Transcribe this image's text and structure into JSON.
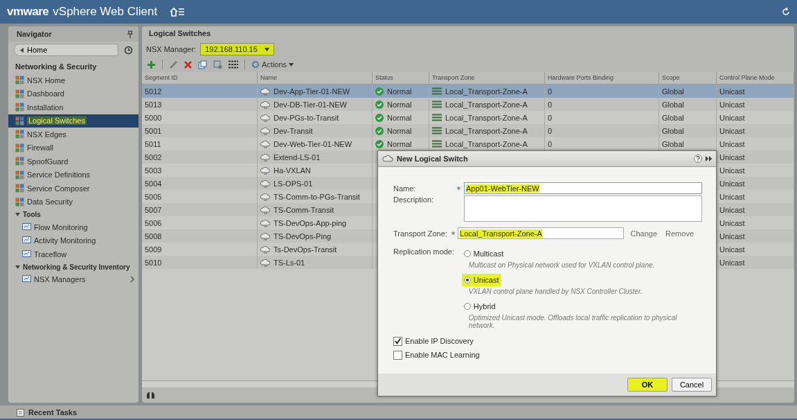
{
  "app_title": {
    "brand": "vmware",
    "product": "vSphere Web Client"
  },
  "navigator": {
    "title": "Navigator",
    "back_label": "Home",
    "items": [
      {
        "kind": "section",
        "label": "Networking & Security"
      },
      {
        "kind": "item",
        "label": "NSX Home",
        "selected": false,
        "highlighted": false
      },
      {
        "kind": "item",
        "label": "Dashboard",
        "selected": false,
        "highlighted": false
      },
      {
        "kind": "item",
        "label": "Installation",
        "selected": false,
        "highlighted": false
      },
      {
        "kind": "item",
        "label": "Logical Switches",
        "selected": true,
        "highlighted": true
      },
      {
        "kind": "item",
        "label": "NSX Edges",
        "selected": false,
        "highlighted": false
      },
      {
        "kind": "item",
        "label": "Firewall",
        "selected": false,
        "highlighted": false
      },
      {
        "kind": "item",
        "label": "SpoofGuard",
        "selected": false,
        "highlighted": false
      },
      {
        "kind": "item",
        "label": "Service Definitions",
        "selected": false,
        "highlighted": false
      },
      {
        "kind": "item",
        "label": "Service Composer",
        "selected": false,
        "highlighted": false
      },
      {
        "kind": "item",
        "label": "Data Security",
        "selected": false,
        "highlighted": false
      },
      {
        "kind": "group",
        "label": "Tools",
        "expanded": true,
        "children": [
          {
            "label": "Flow Monitoring",
            "selected": false,
            "submenu": false
          },
          {
            "label": "Activity Monitoring",
            "selected": false,
            "submenu": false
          },
          {
            "label": "Traceflow",
            "selected": false,
            "submenu": false
          }
        ]
      },
      {
        "kind": "group",
        "label": "Networking & Security Inventory",
        "expanded": true,
        "children": [
          {
            "label": "NSX Managers",
            "selected": false,
            "submenu": true
          }
        ]
      }
    ]
  },
  "main": {
    "title": "Logical Switches",
    "manager_label": "NSX Manager:",
    "manager_value": "192.168.110.15",
    "manager_highlighted": true,
    "actions_label": "Actions",
    "table": {
      "columns": [
        "Segment ID",
        "Name",
        "Status",
        "Transport Zone",
        "Hardware Ports Binding",
        "Scope",
        "Control Plane Mode"
      ],
      "rows": [
        {
          "segment_id": "5012",
          "name": "Dev-App-Tier-01-NEW",
          "status": "Normal",
          "transport_zone": "Local_Transport-Zone-A",
          "hardware_ports_binding": "0",
          "scope": "Global",
          "control_plane_mode": "Unicast",
          "selected": true
        },
        {
          "segment_id": "5013",
          "name": "Dev-DB-Tier-01-NEW",
          "status": "Normal",
          "transport_zone": "Local_Transport-Zone-A",
          "hardware_ports_binding": "0",
          "scope": "Global",
          "control_plane_mode": "Unicast",
          "selected": false
        },
        {
          "segment_id": "5000",
          "name": "Dev-PGs-to-Transit",
          "status": "Normal",
          "transport_zone": "Local_Transport-Zone-A",
          "hardware_ports_binding": "0",
          "scope": "Global",
          "control_plane_mode": "Unicast",
          "selected": false
        },
        {
          "segment_id": "5001",
          "name": "Dev-Transit",
          "status": "Normal",
          "transport_zone": "Local_Transport-Zone-A",
          "hardware_ports_binding": "0",
          "scope": "Global",
          "control_plane_mode": "Unicast",
          "selected": false
        },
        {
          "segment_id": "5011",
          "name": "Dev-Web-Tier-01-NEW",
          "status": "Normal",
          "transport_zone": "Local_Transport-Zone-A",
          "hardware_ports_binding": "0",
          "scope": "Global",
          "control_plane_mode": "Unicast",
          "selected": false
        },
        {
          "segment_id": "5002",
          "name": "Extend-LS-01",
          "control_plane_mode": "Unicast",
          "selected": false
        },
        {
          "segment_id": "5003",
          "name": "Ha-VXLAN",
          "control_plane_mode": "Unicast",
          "selected": false
        },
        {
          "segment_id": "5004",
          "name": "LS-OPS-01",
          "control_plane_mode": "Unicast",
          "selected": false
        },
        {
          "segment_id": "5005",
          "name": "TS-Comm-to-PGs-Transit",
          "control_plane_mode": "Unicast",
          "selected": false
        },
        {
          "segment_id": "5007",
          "name": "TS-Comm-Transit",
          "control_plane_mode": "Unicast",
          "selected": false
        },
        {
          "segment_id": "5006",
          "name": "TS-DevOps-App-ping",
          "control_plane_mode": "Unicast",
          "selected": false
        },
        {
          "segment_id": "5008",
          "name": "TS-DevOps-Ping",
          "control_plane_mode": "Unicast",
          "selected": false
        },
        {
          "segment_id": "5009",
          "name": "Ts-DevOps-Transit",
          "control_plane_mode": "Unicast",
          "selected": false
        },
        {
          "segment_id": "5010",
          "name": "TS-Ls-01",
          "control_plane_mode": "Unicast",
          "selected": false
        }
      ]
    }
  },
  "dialog": {
    "title": "New Logical Switch",
    "name": {
      "label": "Name:",
      "value": "App01-WebTier-NEW",
      "highlighted": true,
      "required": true
    },
    "description": {
      "label": "Description:"
    },
    "transport_zone": {
      "label": "Transport Zone:",
      "value": "Local_Transport-Zone-A",
      "highlighted": true,
      "required": true,
      "links": [
        "Change",
        "Remove"
      ]
    },
    "replication": {
      "label": "Replication mode:",
      "options": [
        {
          "label": "Multicast",
          "description": "Multicast on Physical network used for VXLAN control plane.",
          "selected": false,
          "highlighted": false
        },
        {
          "label": "Unicast",
          "description": "VXLAN control plane handled by NSX Controller Cluster.",
          "selected": true,
          "highlighted": true
        },
        {
          "label": "Hybrid",
          "description": "Optimized Unicast mode. Offloads local traffic replication to physical network.",
          "selected": false,
          "highlighted": false
        }
      ]
    },
    "checkboxes": [
      {
        "label": "Enable IP Discovery",
        "checked": true
      },
      {
        "label": "Enable MAC Learning",
        "checked": false
      }
    ],
    "buttons": [
      {
        "label": "OK",
        "kind": "primary",
        "highlighted": true
      },
      {
        "label": "Cancel",
        "kind": "secondary",
        "highlighted": false
      }
    ]
  },
  "recent_tasks": "Recent Tasks"
}
